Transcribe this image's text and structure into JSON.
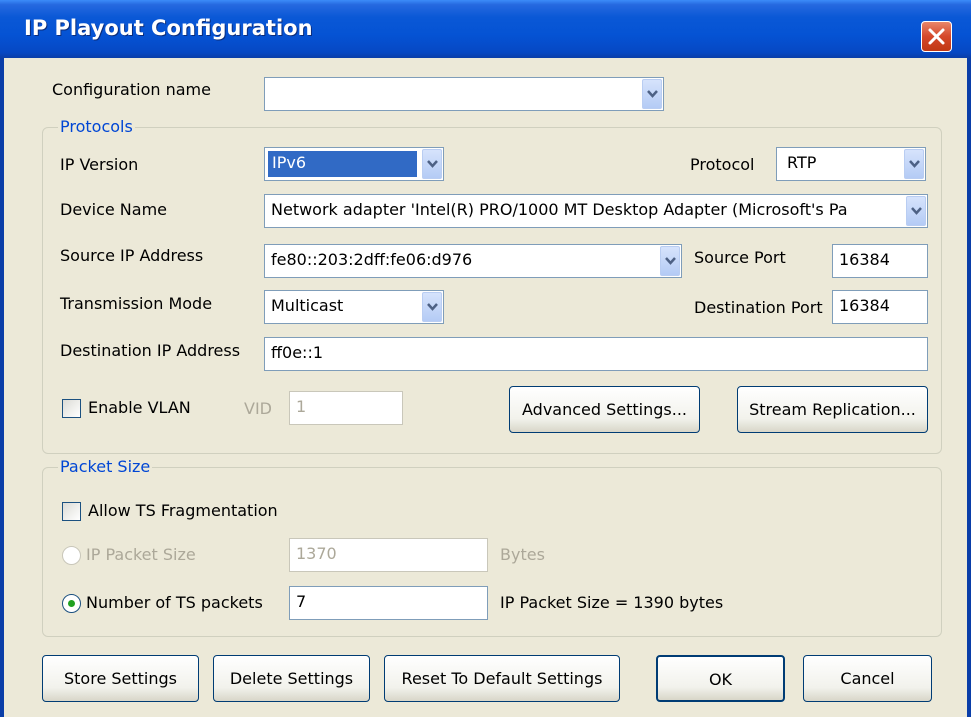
{
  "window": {
    "title": "IP Playout Configuration",
    "close_icon": "close-icon"
  },
  "config": {
    "label": "Configuration name",
    "value": ""
  },
  "protocols": {
    "group_title": "Protocols",
    "ip_version_label": "IP Version",
    "ip_version_value": "IPv6",
    "protocol_label": "Protocol",
    "protocol_value": "RTP",
    "device_name_label": "Device Name",
    "device_name_value": "Network adapter 'Intel(R) PRO/1000 MT Desktop Adapter (Microsoft's Pa",
    "source_ip_label": "Source IP Address",
    "source_ip_value": "fe80::203:2dff:fe06:d976",
    "source_port_label": "Source Port",
    "source_port_value": "16384",
    "transmission_mode_label": "Transmission Mode",
    "transmission_mode_value": "Multicast",
    "destination_port_label": "Destination Port",
    "destination_port_value": "16384",
    "destination_ip_label": "Destination IP Address",
    "destination_ip_value": "ff0e::1",
    "enable_vlan_label": "Enable VLAN",
    "enable_vlan_checked": false,
    "vid_label": "VID",
    "vid_value": "1",
    "advanced_settings_label": "Advanced Settings...",
    "stream_replication_label": "Stream Replication..."
  },
  "packet_size": {
    "group_title": "Packet Size",
    "allow_fragmentation_label": "Allow TS Fragmentation",
    "allow_fragmentation_checked": false,
    "ip_packet_size_label": "IP Packet Size",
    "ip_packet_size_value": "1370",
    "bytes_label": "Bytes",
    "num_ts_packets_label": "Number of TS packets",
    "num_ts_packets_value": "7",
    "num_ts_packets_selected": true,
    "ip_packet_size_result": "IP Packet Size =  1390 bytes"
  },
  "footer": {
    "store_settings": "Store Settings",
    "delete_settings": "Delete Settings",
    "reset_default": "Reset To Default Settings",
    "ok": "OK",
    "cancel": "Cancel"
  },
  "colors": {
    "titlebar": "#0553d4",
    "dialog_bg": "#ece9d8",
    "group_title": "#0046d5",
    "selection": "#316ac5",
    "radio_dot": "#21a121"
  }
}
